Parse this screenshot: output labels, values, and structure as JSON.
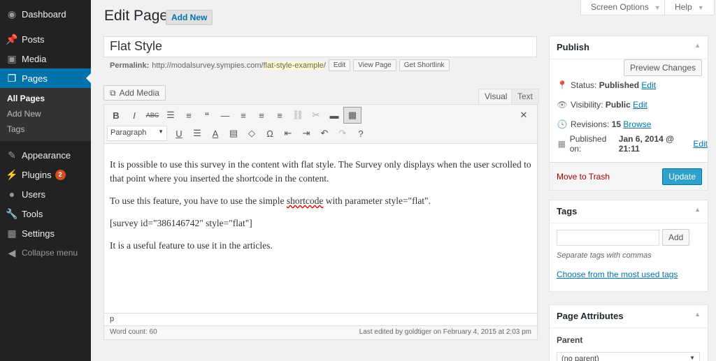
{
  "sidebar": {
    "items": [
      {
        "label": "Dashboard",
        "icon": "dashboard-icon"
      },
      {
        "label": "Posts",
        "icon": "pin-icon"
      },
      {
        "label": "Media",
        "icon": "media-icon"
      },
      {
        "label": "Pages",
        "icon": "pages-icon"
      },
      {
        "label": "Appearance",
        "icon": "brush-icon"
      },
      {
        "label": "Plugins",
        "icon": "plug-icon",
        "badge": "2"
      },
      {
        "label": "Users",
        "icon": "user-icon"
      },
      {
        "label": "Tools",
        "icon": "wrench-icon"
      },
      {
        "label": "Settings",
        "icon": "settings-icon"
      },
      {
        "label": "Collapse menu",
        "icon": "collapse-icon"
      }
    ],
    "submenu": [
      "All Pages",
      "Add New",
      "Tags"
    ]
  },
  "header": {
    "title": "Edit Page",
    "add_new": "Add New",
    "screen_options": "Screen Options",
    "help": "Help"
  },
  "editor": {
    "post_title": "Flat Style",
    "permalink_label": "Permalink:",
    "permalink_base": "http://modalsurvey.sympies.com/",
    "permalink_slug": "flat-style-example",
    "permalink_trail": "/",
    "edit_btn": "Edit",
    "view_btn": "View Page",
    "shortlink_btn": "Get Shortlink",
    "add_media": "Add Media",
    "tab_visual": "Visual",
    "tab_text": "Text",
    "format_select": "Paragraph",
    "paragraphs": [
      "It is possible to use this survey in the content with flat style. The Survey only displays when the user scrolled to that point where you inserted the shortcode in the content.",
      "To use this feature, you have to use the simple ",
      "shortcode",
      " with parameter style=\"flat\".",
      "[survey id=\"386146742\" style=\"flat\"]",
      "It is a useful feature to use it in the articles."
    ],
    "path": "p",
    "word_count": "Word count: 60",
    "last_edited": "Last edited by goldtiger on February 4, 2015 at 2:03 pm"
  },
  "publish": {
    "title": "Publish",
    "preview": "Preview Changes",
    "status_label": "Status:",
    "status_value": "Published",
    "visibility_label": "Visibility:",
    "visibility_value": "Public",
    "revisions_label": "Revisions:",
    "revisions_value": "15",
    "revisions_link": "Browse",
    "published_label": "Published on:",
    "published_value": "Jan 6, 2014 @ 21:11",
    "edit": "Edit",
    "trash": "Move to Trash",
    "update": "Update"
  },
  "tags": {
    "title": "Tags",
    "add": "Add",
    "hint": "Separate tags with commas",
    "choose": "Choose from the most used tags"
  },
  "attributes": {
    "title": "Page Attributes",
    "parent_label": "Parent",
    "parent_value": "(no parent)"
  }
}
